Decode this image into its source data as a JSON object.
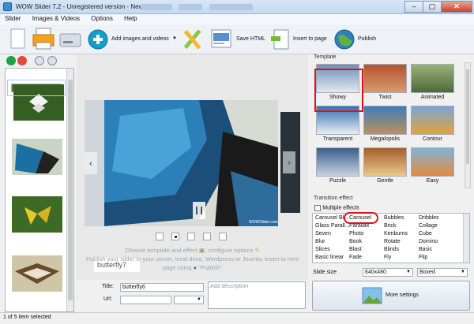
{
  "window": {
    "title": "WOW Slider 7.2 - Unregistered version - New Slider",
    "buttons": [
      "–",
      "▢",
      "✕"
    ]
  },
  "menu": [
    "Slider",
    "Images & Videos",
    "Options",
    "Help"
  ],
  "toolbar": {
    "add_label": "Add images and videos",
    "save_html_label": "Save HTML",
    "insert_label": "Insert to page",
    "publish_label": "Publish"
  },
  "slides": {
    "count_text": "1 of 5 item selected",
    "caption": "butterfly7"
  },
  "preview": {
    "help_line1": "Choose template and effect",
    "help_line1_b": ", configure options",
    "help_line2": "Publish your slider to your server, local drive, Wordpress or Joomla, insert to html",
    "help_line3a": "page using",
    "help_line3b": "\"Publish\"",
    "watermark": "WOWSlider.com"
  },
  "properties": {
    "title_label": "Title:",
    "title_value": "butterfly6",
    "url_label": "Url:",
    "url_value": "",
    "description_placeholder": "Add description"
  },
  "template": {
    "section_label": "Template",
    "items": [
      "Showy",
      "Twist",
      "Animated",
      "Transparent",
      "Megalopolis",
      "Contour",
      "Puzzle",
      "Gentle",
      "Easy"
    ],
    "selected": "Showy"
  },
  "effects": {
    "section_label": "Transition effect",
    "multiple_label": "Multiple effects",
    "columns": [
      [
        "Carousel Bl...",
        "Glass Parall...",
        "Seven",
        "Blur",
        "Slices",
        "Basic linear"
      ],
      [
        "Carousel",
        "Parallax",
        "Photo",
        "Book",
        "Blast",
        "Fade"
      ],
      [
        "Bubbles",
        "Brick",
        "Kenburns",
        "Rotate",
        "Blinds",
        "Fly"
      ],
      [
        "Dribbles",
        "Collage",
        "Cube",
        "Domino",
        "Basic",
        "Flip"
      ]
    ],
    "selected": "Carousel"
  },
  "settings": {
    "size_label": "Slide size",
    "size_value": "640x480",
    "mode_value": "Boxed",
    "more_label": "More settings"
  },
  "colors": {
    "highlight_red": "#d9131b",
    "add_icon": "#13a0c8",
    "toolbar_bg": "#eef2f7"
  }
}
